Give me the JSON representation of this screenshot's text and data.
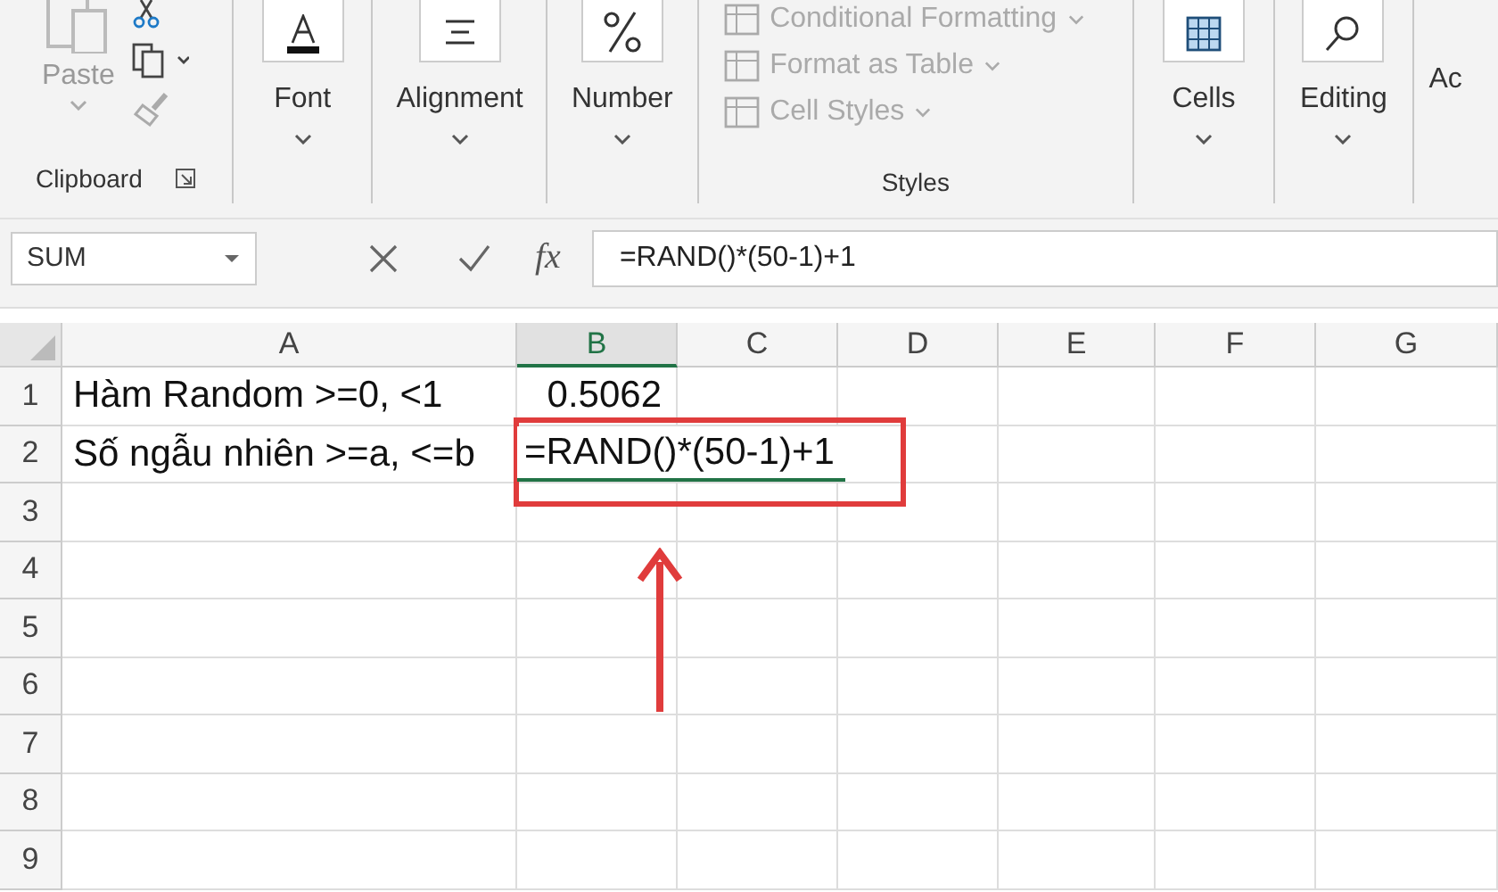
{
  "ribbon": {
    "groups": [
      {
        "kind": "clipboard",
        "label": "Clipboard",
        "paste": "Paste"
      },
      {
        "kind": "font",
        "label": "Font"
      },
      {
        "kind": "alignment",
        "label": "Alignment"
      },
      {
        "kind": "number",
        "label": "Number"
      },
      {
        "kind": "styles",
        "label": "Styles",
        "items": [
          "Conditional Formatting",
          "Format as Table",
          "Cell Styles"
        ]
      },
      {
        "kind": "cells",
        "label": "Cells"
      },
      {
        "kind": "editing",
        "label": "Editing"
      },
      {
        "kind": "cut",
        "label": "Ac"
      }
    ]
  },
  "formula_bar": {
    "name_box": "SUM",
    "formula": "=RAND()*(50-1)+1",
    "fx": "fx"
  },
  "sheet": {
    "columns": [
      {
        "label": "A",
        "selected": false
      },
      {
        "label": "B",
        "selected": true
      },
      {
        "label": "C",
        "selected": false
      },
      {
        "label": "D",
        "selected": false
      },
      {
        "label": "E",
        "selected": false
      },
      {
        "label": "F",
        "selected": false
      },
      {
        "label": "G",
        "selected": false
      }
    ],
    "rows": [
      {
        "number": "1",
        "cells": [
          {
            "text": "Hàm Random >=0, <1",
            "editing": false
          },
          {
            "text": "0.5062",
            "editing": false
          }
        ]
      },
      {
        "number": "2",
        "cells": [
          {
            "text": "Số ngẫu nhiên >=a, <=b",
            "editing": false
          },
          {
            "text": "=RAND()*(50-1)+1",
            "editing": true
          }
        ]
      },
      {
        "number": "3",
        "cells": []
      },
      {
        "number": "4",
        "cells": []
      },
      {
        "number": "5",
        "cells": []
      },
      {
        "number": "6",
        "cells": []
      },
      {
        "number": "7",
        "cells": []
      },
      {
        "number": "8",
        "cells": []
      },
      {
        "number": "9",
        "cells": []
      }
    ]
  }
}
